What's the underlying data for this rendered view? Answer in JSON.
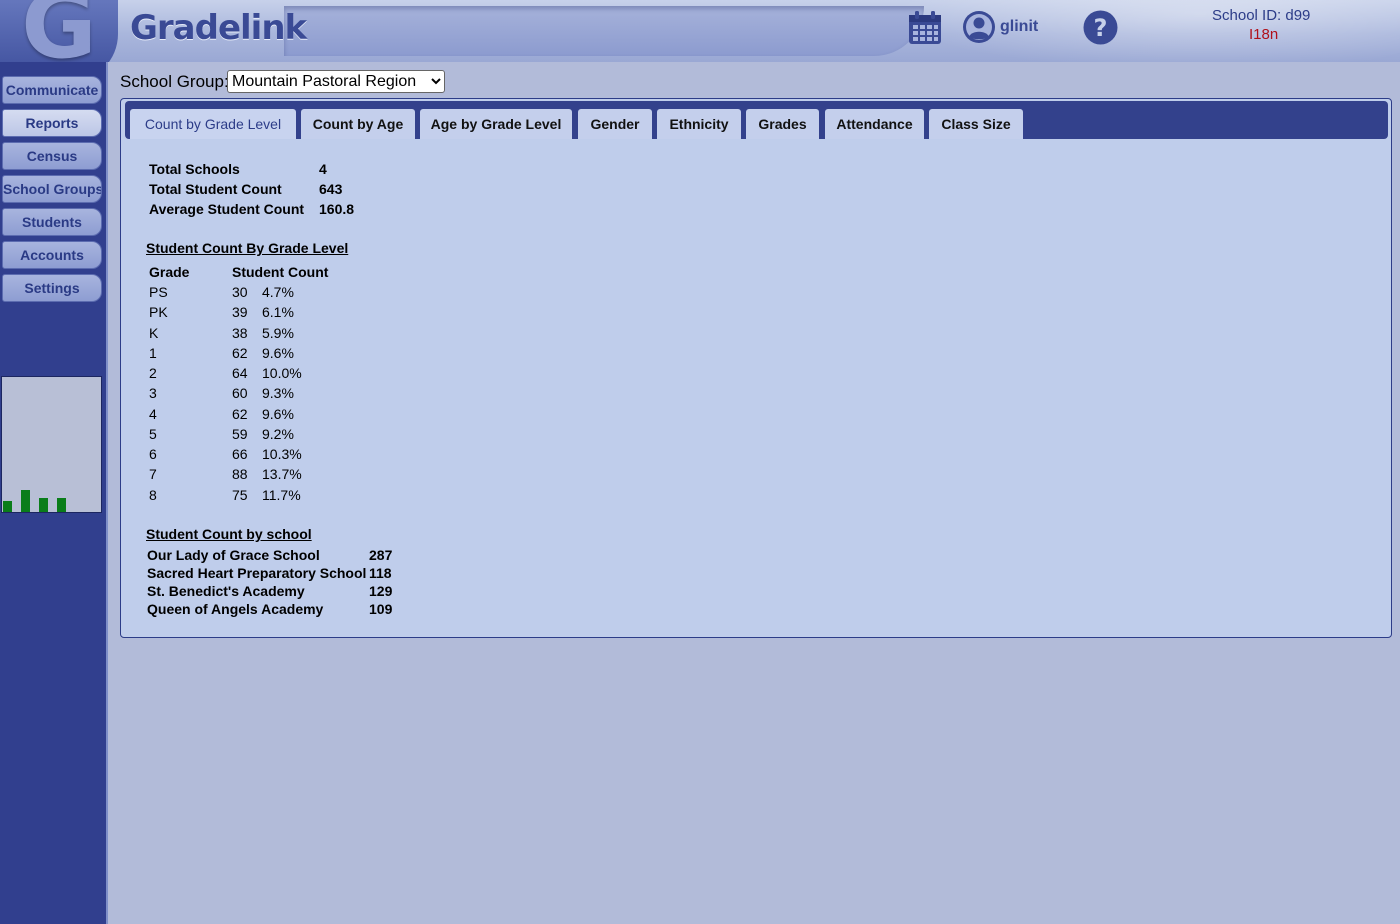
{
  "header": {
    "app_name": "Gradelink",
    "logo_letter": "G",
    "username": "glinit",
    "school_id": "School ID:  d99",
    "locale": "I18n"
  },
  "sidebar": {
    "items": [
      {
        "label": "Communicate"
      },
      {
        "label": "Reports"
      },
      {
        "label": "Census"
      },
      {
        "label": "School Groups"
      },
      {
        "label": "Students"
      },
      {
        "label": "Accounts"
      },
      {
        "label": "Settings"
      }
    ],
    "mini_chart": {
      "bar_color": "#0a7d1a",
      "bar_levels": [
        0.08,
        0.16,
        0.1,
        0.1
      ]
    }
  },
  "school_group": {
    "label": "School Group:",
    "selected": "Mountain Pastoral Region"
  },
  "tabs": [
    {
      "label": "Count by Grade Level"
    },
    {
      "label": "Count by Age"
    },
    {
      "label": "Age by Grade Level"
    },
    {
      "label": "Gender"
    },
    {
      "label": "Ethnicity"
    },
    {
      "label": "Grades"
    },
    {
      "label": "Attendance"
    },
    {
      "label": "Class Size"
    }
  ],
  "summary": [
    {
      "label": "Total Schools",
      "value": "4"
    },
    {
      "label": "Total Student Count",
      "value": "643"
    },
    {
      "label": "Average Student Count",
      "value": "160.8"
    }
  ],
  "grade_section": {
    "title": "Student Count By Grade Level",
    "col_grade": "Grade",
    "col_count": "Student Count",
    "rows": [
      {
        "grade": "PS",
        "count": "30",
        "pct": "4.7%"
      },
      {
        "grade": "PK",
        "count": "39",
        "pct": "6.1%"
      },
      {
        "grade": "K",
        "count": "38",
        "pct": "5.9%"
      },
      {
        "grade": "1",
        "count": "62",
        "pct": "9.6%"
      },
      {
        "grade": "2",
        "count": "64",
        "pct": "10.0%"
      },
      {
        "grade": "3",
        "count": "60",
        "pct": "9.3%"
      },
      {
        "grade": "4",
        "count": "62",
        "pct": "9.6%"
      },
      {
        "grade": "5",
        "count": "59",
        "pct": "9.2%"
      },
      {
        "grade": "6",
        "count": "66",
        "pct": "10.3%"
      },
      {
        "grade": "7",
        "count": "88",
        "pct": "13.7%"
      },
      {
        "grade": "8",
        "count": "75",
        "pct": "11.7%"
      }
    ]
  },
  "school_section": {
    "title": "Student Count by school",
    "rows": [
      {
        "name": "Our Lady of Grace School",
        "count": "287"
      },
      {
        "name": "Sacred Heart Preparatory School",
        "count": "118"
      },
      {
        "name": "St. Benedict's Academy",
        "count": "129"
      },
      {
        "name": "Queen of Angels Academy",
        "count": "109"
      }
    ]
  },
  "colors": {
    "sidebar_bg": "#313f8e",
    "tabbar_bg": "#33418c",
    "panel_bg": "#bfcdeb",
    "page_bg": "#b2bbd9",
    "locale_text": "#b0101a"
  }
}
